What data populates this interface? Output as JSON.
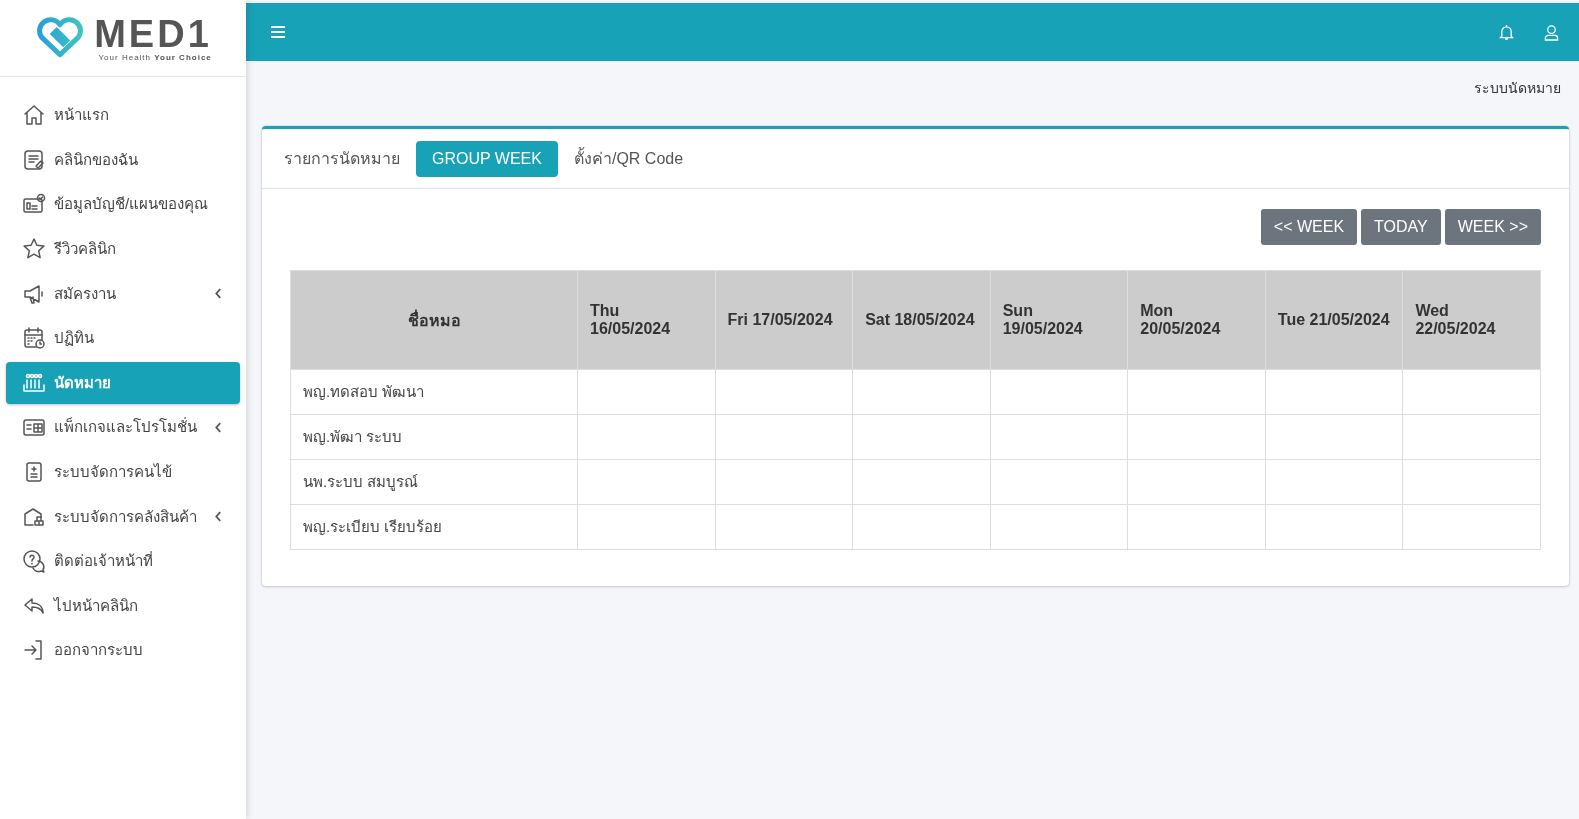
{
  "logo": {
    "name": "MED1",
    "tagline_plain": "Your Health",
    "tagline_bold": "Your Choice"
  },
  "sidebar": {
    "items": [
      {
        "label": "หน้าแรก",
        "selected": false,
        "expandable": false
      },
      {
        "label": "คลินิกของฉัน",
        "selected": false,
        "expandable": false
      },
      {
        "label": "ข้อมูลบัญชี/แผนของคุณ",
        "selected": false,
        "expandable": false
      },
      {
        "label": "รีวิวคลินิก",
        "selected": false,
        "expandable": false
      },
      {
        "label": "สมัครงาน",
        "selected": false,
        "expandable": true
      },
      {
        "label": "ปฏิทิน",
        "selected": false,
        "expandable": false
      },
      {
        "label": "นัดหมาย",
        "selected": true,
        "expandable": false
      },
      {
        "label": "แพ็กเกจและโปรโมชั่น",
        "selected": false,
        "expandable": true
      },
      {
        "label": "ระบบจัดการคนไข้",
        "selected": false,
        "expandable": false
      },
      {
        "label": "ระบบจัดการคลังสินค้า",
        "selected": false,
        "expandable": true
      },
      {
        "label": "ติดต่อเจ้าหน้าที่",
        "selected": false,
        "expandable": false
      },
      {
        "label": "ไปหน้าคลินิก",
        "selected": false,
        "expandable": false
      },
      {
        "label": "ออกจากระบบ",
        "selected": false,
        "expandable": false
      }
    ]
  },
  "breadcrumb": "ระบบนัดหมาย",
  "tabs": [
    {
      "label": "รายการนัดหมาย",
      "selected": false
    },
    {
      "label": "GROUP WEEK",
      "selected": true
    },
    {
      "label": "ตั้งค่า/QR Code",
      "selected": false
    }
  ],
  "week_buttons": [
    "<< WEEK",
    "TODAY",
    "WEEK >>"
  ],
  "table": {
    "columns": [
      "ชื่อหมอ",
      "Thu 16/05/2024",
      "Fri 17/05/2024",
      "Sat 18/05/2024",
      "Sun 19/05/2024",
      "Mon 20/05/2024",
      "Tue 21/05/2024",
      "Wed 22/05/2024"
    ],
    "rows": [
      {
        "doctor": "พญ.ทดสอบ พัฒนา"
      },
      {
        "doctor": "พญ.พัฒา ระบบ"
      },
      {
        "doctor": "นพ.ระบบ สมบูรณ์"
      },
      {
        "doctor": "พญ.ระเบียบ เรียบร้อย"
      }
    ]
  }
}
